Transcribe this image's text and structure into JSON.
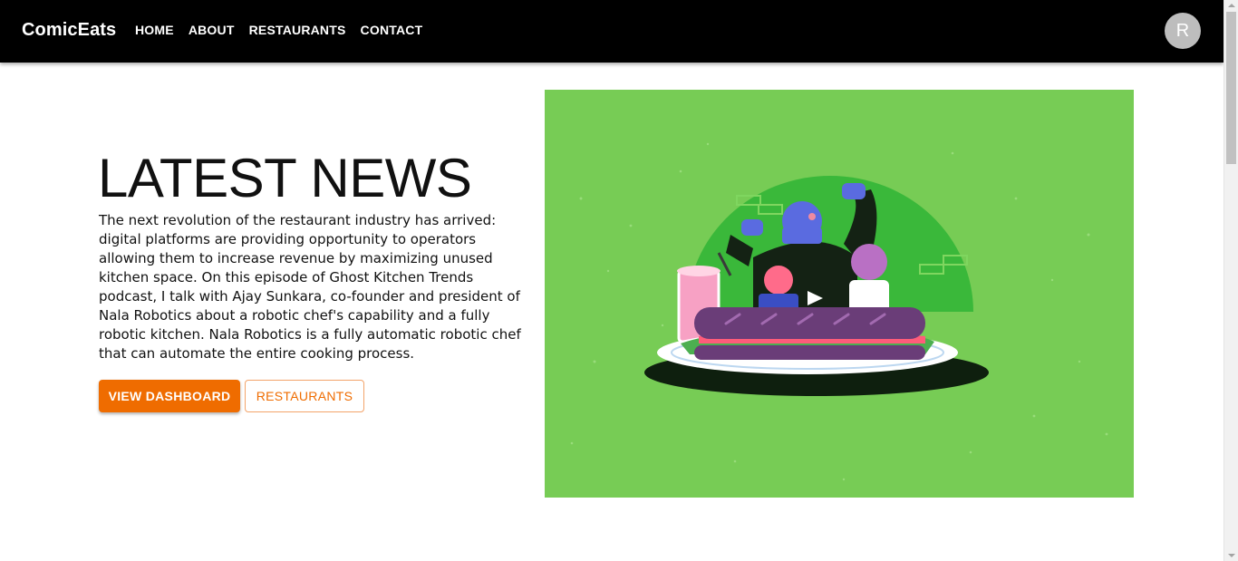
{
  "navbar": {
    "brand": "ComicEats",
    "links": [
      {
        "label": "HOME"
      },
      {
        "label": "ABOUT"
      },
      {
        "label": "RESTAURANTS"
      },
      {
        "label": "CONTACT"
      }
    ],
    "avatar_initial": "R"
  },
  "main": {
    "title": "LATEST NEWS",
    "body": "The next revolution of the restaurant industry has arrived: digital platforms are providing opportunity to operators allowing them to increase revenue by maximizing unused kitchen space. On this episode of Ghost Kitchen Trends podcast, I talk with Ajay Sunkara, co-founder and president of Nala Robotics about a robotic chef's capability and a fully robotic kitchen. Nala Robotics is a fully automatic robotic chef that can automate the entire cooking process.",
    "primary_button": "VIEW DASHBOARD",
    "secondary_button": "RESTAURANTS"
  },
  "colors": {
    "navbar_bg": "#000000",
    "accent": "#ef6c00",
    "hero_bg": "#77cc55"
  }
}
